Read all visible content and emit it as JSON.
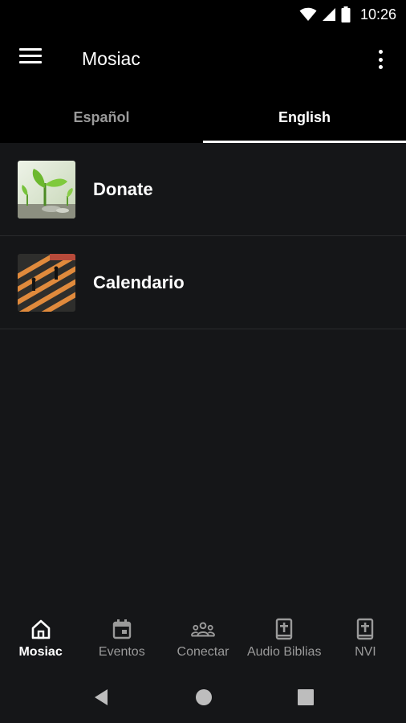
{
  "status_bar": {
    "time": "10:26",
    "icons": [
      "wifi-icon",
      "signal-icon",
      "battery-icon"
    ]
  },
  "app_bar": {
    "title": "Mosiac",
    "icons": [
      "menu-icon",
      "more-vert-icon"
    ]
  },
  "tabs": [
    {
      "label": "Español",
      "active": false
    },
    {
      "label": "English",
      "active": true
    }
  ],
  "list": [
    {
      "label": "Donate",
      "thumbnail": "plant-sprout-image"
    },
    {
      "label": "Calendario",
      "thumbnail": "crosswalk-figures-image"
    }
  ],
  "bottom_nav": [
    {
      "label": "Mosiac",
      "icon": "home-icon",
      "active": true
    },
    {
      "label": "Eventos",
      "icon": "calendar-icon",
      "active": false
    },
    {
      "label": "Conectar",
      "icon": "group-icon",
      "active": false
    },
    {
      "label": "Audio Biblias",
      "icon": "bible-icon",
      "active": false
    },
    {
      "label": "NVI",
      "icon": "bible-icon",
      "active": false
    }
  ],
  "system_nav": [
    "back-icon",
    "home-circle-icon",
    "recents-icon"
  ],
  "colors": {
    "background": "#151618",
    "bar_background": "#000000",
    "active_text": "#ffffff",
    "inactive_text": "#9a9a9a",
    "divider": "#2a2b2d"
  }
}
